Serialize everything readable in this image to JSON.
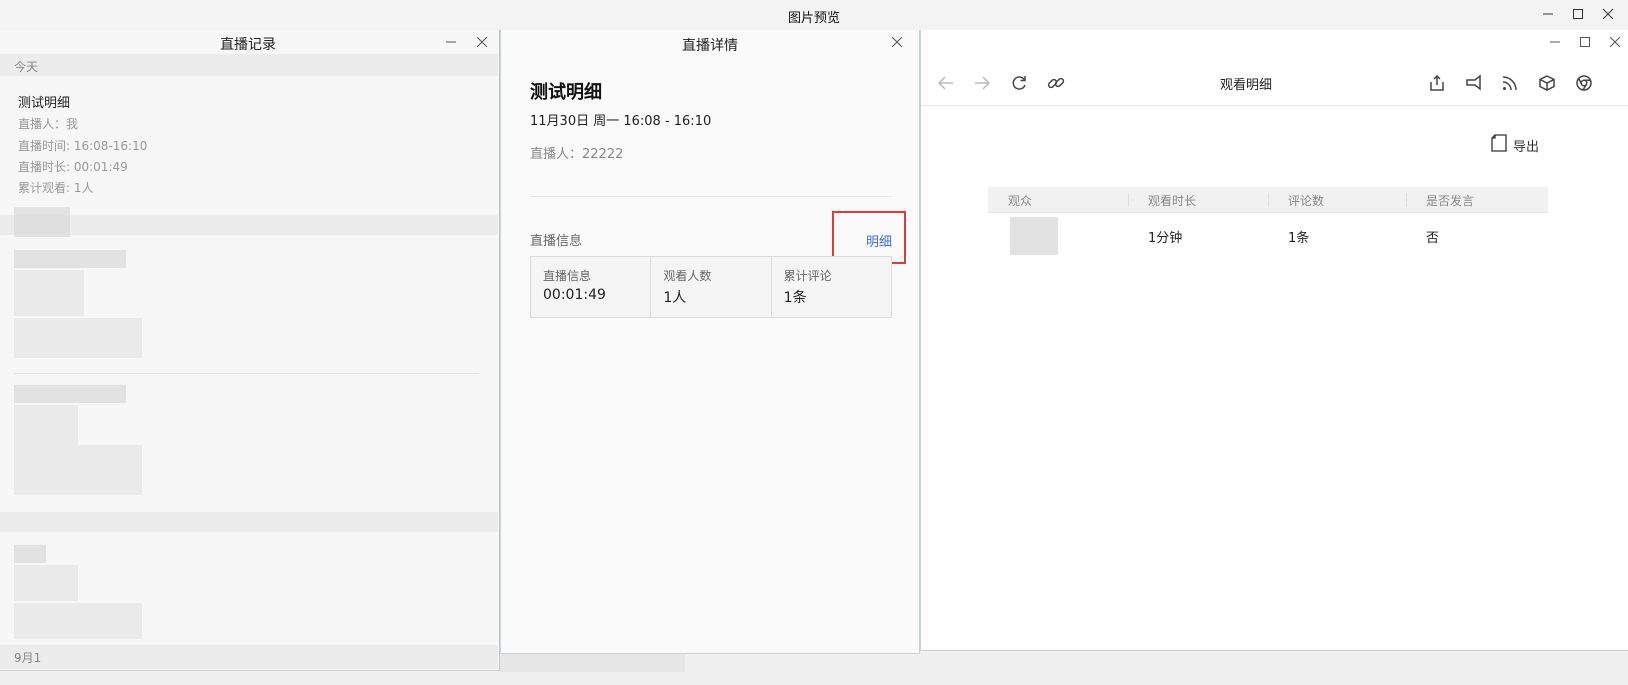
{
  "preview": {
    "title": "图片预览"
  },
  "records_window": {
    "title": "直播记录",
    "today_label": "今天",
    "record": {
      "title": "测试明细",
      "host": "直播人：我",
      "time": "直播时间: 16:08-16:10",
      "duration": "直播时长: 00:01:49",
      "views": "累计观看: 1人"
    },
    "footer_date": "9月1"
  },
  "detail_window": {
    "title": "直播详情",
    "live_title": "测试明细",
    "time": "11月30日 周一 16:08 - 16:10",
    "host": "直播人：22222",
    "info_label": "直播信息",
    "detail_link": "明细",
    "stats": [
      {
        "label": "直播信息",
        "value": "00:01:49"
      },
      {
        "label": "观看人数",
        "value": "1人"
      },
      {
        "label": "累计评论",
        "value": "1条"
      }
    ]
  },
  "viewer_window": {
    "title": "观看明细",
    "export_label": "导出",
    "columns": [
      "观众",
      "观看时长",
      "评论数",
      "是否发言"
    ],
    "rows": [
      {
        "duration": "1分钟",
        "comments": "1条",
        "spoke": "否"
      }
    ]
  }
}
